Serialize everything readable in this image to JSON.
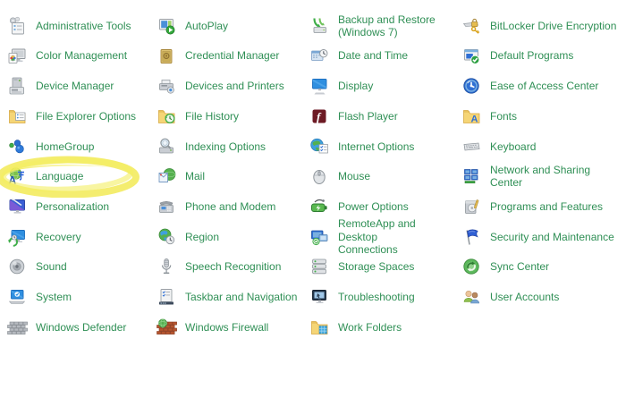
{
  "window": {
    "background": "#ffffff"
  },
  "style": {
    "link_color": "#2f8f55",
    "highlight_color": "#f1e94f"
  },
  "control_panel": {
    "columns": 4,
    "items": [
      {
        "label": "Administrative Tools",
        "icon": "admin-tools-icon"
      },
      {
        "label": "AutoPlay",
        "icon": "autoplay-icon"
      },
      {
        "label": "Backup and Restore",
        "label2": "(Windows 7)",
        "icon": "backup-restore-icon"
      },
      {
        "label": "BitLocker Drive Encryption",
        "icon": "bitlocker-icon"
      },
      {
        "label": "Color Management",
        "icon": "color-management-icon"
      },
      {
        "label": "Credential Manager",
        "icon": "credential-manager-icon"
      },
      {
        "label": "Date and Time",
        "icon": "date-time-icon"
      },
      {
        "label": "Default Programs",
        "icon": "default-programs-icon"
      },
      {
        "label": "Device Manager",
        "icon": "device-manager-icon"
      },
      {
        "label": "Devices and Printers",
        "icon": "devices-printers-icon"
      },
      {
        "label": "Display",
        "icon": "display-icon"
      },
      {
        "label": "Ease of Access Center",
        "icon": "ease-of-access-icon"
      },
      {
        "label": "File Explorer Options",
        "icon": "file-explorer-options-icon"
      },
      {
        "label": "File History",
        "icon": "file-history-icon"
      },
      {
        "label": "Flash Player",
        "icon": "flash-player-icon"
      },
      {
        "label": "Fonts",
        "icon": "fonts-icon"
      },
      {
        "label": "HomeGroup",
        "icon": "homegroup-icon"
      },
      {
        "label": "Indexing Options",
        "icon": "indexing-options-icon"
      },
      {
        "label": "Internet Options",
        "icon": "internet-options-icon"
      },
      {
        "label": "Keyboard",
        "icon": "keyboard-icon"
      },
      {
        "label": "Language",
        "icon": "language-icon",
        "highlighted": true
      },
      {
        "label": "Mail",
        "icon": "mail-icon"
      },
      {
        "label": "Mouse",
        "icon": "mouse-icon"
      },
      {
        "label": "Network and Sharing",
        "label2": "Center",
        "icon": "network-sharing-icon"
      },
      {
        "label": "Personalization",
        "icon": "personalization-icon"
      },
      {
        "label": "Phone and Modem",
        "icon": "phone-modem-icon"
      },
      {
        "label": "Power Options",
        "icon": "power-options-icon"
      },
      {
        "label": "Programs and Features",
        "icon": "programs-features-icon"
      },
      {
        "label": "Recovery",
        "icon": "recovery-icon"
      },
      {
        "label": "Region",
        "icon": "region-icon"
      },
      {
        "label": "RemoteApp and Desktop",
        "label2": "Connections",
        "icon": "remoteapp-icon"
      },
      {
        "label": "Security and Maintenance",
        "icon": "security-maintenance-icon"
      },
      {
        "label": "Sound",
        "icon": "sound-icon"
      },
      {
        "label": "Speech Recognition",
        "icon": "speech-recognition-icon"
      },
      {
        "label": "Storage Spaces",
        "icon": "storage-spaces-icon"
      },
      {
        "label": "Sync Center",
        "icon": "sync-center-icon"
      },
      {
        "label": "System",
        "icon": "system-icon"
      },
      {
        "label": "Taskbar and Navigation",
        "icon": "taskbar-navigation-icon"
      },
      {
        "label": "Troubleshooting",
        "icon": "troubleshooting-icon"
      },
      {
        "label": "User Accounts",
        "icon": "user-accounts-icon"
      },
      {
        "label": "Windows Defender",
        "icon": "windows-defender-icon"
      },
      {
        "label": "Windows Firewall",
        "icon": "windows-firewall-icon"
      },
      {
        "label": "Work Folders",
        "icon": "work-folders-icon"
      }
    ]
  }
}
